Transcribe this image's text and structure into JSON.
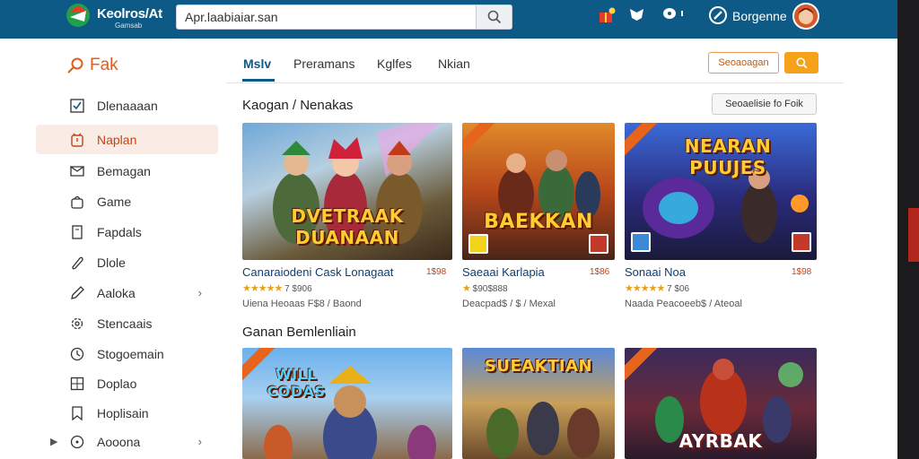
{
  "header": {
    "logo_text": "Keolros/At",
    "logo_sub": "Gamsab",
    "search_value": "Apr.laabiaiar.san",
    "user_name": "Borgenne"
  },
  "sidebar": {
    "title": "Fak",
    "items": [
      {
        "label": "Dlenaaaan",
        "icon": "checkbox-icon",
        "active": false,
        "chevron": false
      },
      {
        "label": "Naplan",
        "icon": "alarm-clock-icon",
        "active": true,
        "chevron": false
      },
      {
        "label": "Bemagan",
        "icon": "send-icon",
        "active": false,
        "chevron": false
      },
      {
        "label": "Game",
        "icon": "bag-icon",
        "active": false,
        "chevron": false
      },
      {
        "label": "Fapdals",
        "icon": "file-icon",
        "active": false,
        "chevron": false
      },
      {
        "label": "Dlole",
        "icon": "link-icon",
        "active": false,
        "chevron": false
      },
      {
        "label": "Aaloka",
        "icon": "pen-icon",
        "active": false,
        "chevron": true
      },
      {
        "label": "Stencaais",
        "icon": "gear-icon",
        "active": false,
        "chevron": false
      },
      {
        "label": "Stogoemain",
        "icon": "clock-icon",
        "active": false,
        "chevron": false
      },
      {
        "label": "Doplao",
        "icon": "grid-icon",
        "active": false,
        "chevron": false
      },
      {
        "label": "Hoplisain",
        "icon": "bookmark-icon",
        "active": false,
        "chevron": false
      },
      {
        "label": "Aooona",
        "icon": "circle-icon",
        "active": false,
        "chevron": true
      }
    ]
  },
  "tabs": [
    {
      "label": "Mslv",
      "active": true
    },
    {
      "label": "Preramans",
      "active": false
    },
    {
      "label": "Kglfes",
      "active": false
    },
    {
      "label": "Nkian",
      "active": false
    }
  ],
  "toolbar": {
    "pill_label": "Seoaoagan"
  },
  "section1": {
    "title": "Kaogan / Nenakas",
    "filter_label": "Seoaelisie fo Foik",
    "cards": [
      {
        "art": "DVETRAAK DUANAAN",
        "title": "Canaraiodeni Cask Lonagaat",
        "price": "1$98",
        "rating_text": "7 $906",
        "meta": "Uiena Heoaas F$8 / Baond"
      },
      {
        "art": "BAEKKAN",
        "title": "Saeaai Karlapia",
        "price": "1$86",
        "rating_text": "$90$888",
        "meta": "Deacpad$ / $ / Mexal"
      },
      {
        "art": "NEARAN PUUJES",
        "title": "Sonaai Noa",
        "price": "1$98",
        "rating_text": "7 $06",
        "meta": "Naada Peacoeeb$ / Ateoal"
      }
    ]
  },
  "section2": {
    "title": "Ganan Bemlenliain",
    "cards": [
      {
        "art": "WILL CODAS"
      },
      {
        "art": "SUEAKTIAN"
      },
      {
        "art": "AYRBAK"
      }
    ]
  },
  "colors": {
    "header": "#0e5a86",
    "accent": "#e35b1d",
    "link": "#0e3e72",
    "star": "#e6a21b"
  }
}
